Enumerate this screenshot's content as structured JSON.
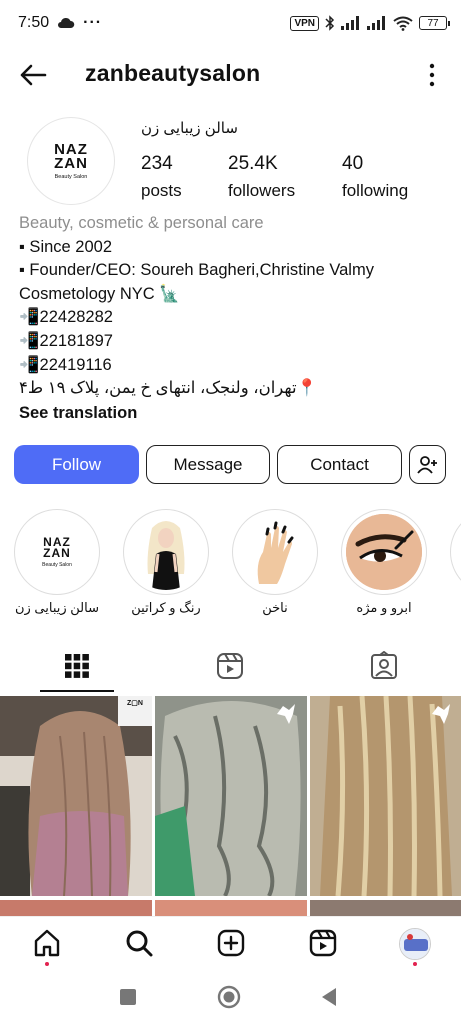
{
  "status_bar": {
    "time": "7:50",
    "overflow": "···",
    "vpn": "VPN",
    "battery": "77",
    "icons": [
      "cloud-icon",
      "bluetooth-icon",
      "signal-icon",
      "signal-icon",
      "wifi-icon",
      "battery-icon"
    ]
  },
  "header": {
    "username": "zanbeautysalon",
    "back_icon": "arrow-left-icon",
    "more_icon": "kebab-menu-icon"
  },
  "profile": {
    "logo_line1": "NAZ",
    "logo_line2": "ZAN",
    "logo_sub": "Beauty Salon",
    "full_name": "سالن زیبایی زن",
    "posts_count": "234",
    "posts_label": "posts",
    "followers_count": "25.4K",
    "followers_label": "followers",
    "following_count": "40",
    "following_label": "following"
  },
  "bio": {
    "category": "Beauty, cosmetic & personal care",
    "lines": [
      "▪ Since 2002",
      "▪ Founder/CEO: Soureh Bagheri,Christine Valmy",
      "Cosmetology NYC 🗽",
      "📲22428282",
      "📲22181897",
      "📲22419116"
    ],
    "address": "📍تهران، ولنجک، انتهای خ یمن، پلاک ۱۹ ط۴",
    "see_translation": "See translation"
  },
  "actions": {
    "follow": "Follow",
    "message": "Message",
    "contact": "Contact",
    "add_user_icon": "person-add-icon"
  },
  "highlights": [
    {
      "label": "سالن زیبایی زن"
    },
    {
      "label": "رنگ و کراتین"
    },
    {
      "label": "ناخن"
    },
    {
      "label": "ابرو و مژه"
    }
  ],
  "tabs": [
    {
      "name": "grid-icon",
      "active": true
    },
    {
      "name": "reels-icon",
      "active": false
    },
    {
      "name": "tagged-icon",
      "active": false
    }
  ],
  "bottom_nav": [
    "home-icon",
    "search-icon",
    "create-icon",
    "reels-icon",
    "profile-avatar"
  ],
  "system_nav": [
    "recents-square-icon",
    "home-circle-icon",
    "back-triangle-icon"
  ],
  "colors": {
    "follow_button": "#4f6cf6",
    "category_text": "#8e8e8e",
    "notification_dot": "#e2224f"
  }
}
